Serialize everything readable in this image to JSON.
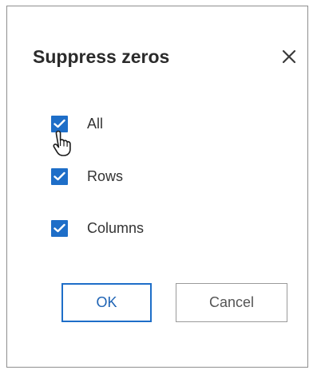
{
  "dialog": {
    "title": "Suppress zeros",
    "close_icon": "close-icon",
    "options": [
      {
        "label": "All",
        "checked": true
      },
      {
        "label": "Rows",
        "checked": true
      },
      {
        "label": "Columns",
        "checked": true
      }
    ],
    "buttons": {
      "ok_label": "OK",
      "cancel_label": "Cancel"
    }
  },
  "colors": {
    "accent": "#1e6ec8",
    "text": "#333333",
    "border": "#8f8f8f"
  },
  "cursor_icon": "hand-pointer-icon"
}
